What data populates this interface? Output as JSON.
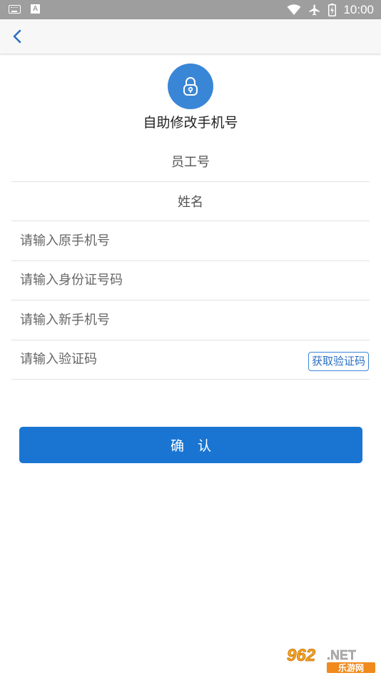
{
  "status_bar": {
    "time": "10:00",
    "left_icons": [
      "keyboard-icon",
      "a-icon"
    ],
    "a_label": "A",
    "right_icons": [
      "wifi-icon",
      "airplane-icon",
      "battery-icon"
    ]
  },
  "toolbar": {
    "back_icon": "chevron-left-icon"
  },
  "header": {
    "icon": "lock-icon",
    "title": "自助修改手机号"
  },
  "form": {
    "employee_id_label": "员工号",
    "name_label": "姓名",
    "old_phone_placeholder": "请输入原手机号",
    "id_card_placeholder": "请输入身份证号码",
    "new_phone_placeholder": "请输入新手机号",
    "code_placeholder": "请输入验证码",
    "get_code_label": "获取验证码"
  },
  "confirm": {
    "label": "确　认"
  },
  "watermark": {
    "brand": "962.NET",
    "brand_prefix": "962",
    "brand_suffix": ".NET",
    "sub": "乐游网"
  },
  "colors": {
    "accent": "#1a75d2",
    "lock_circle": "#3a86d6",
    "status_bar": "#9e9e9e"
  }
}
